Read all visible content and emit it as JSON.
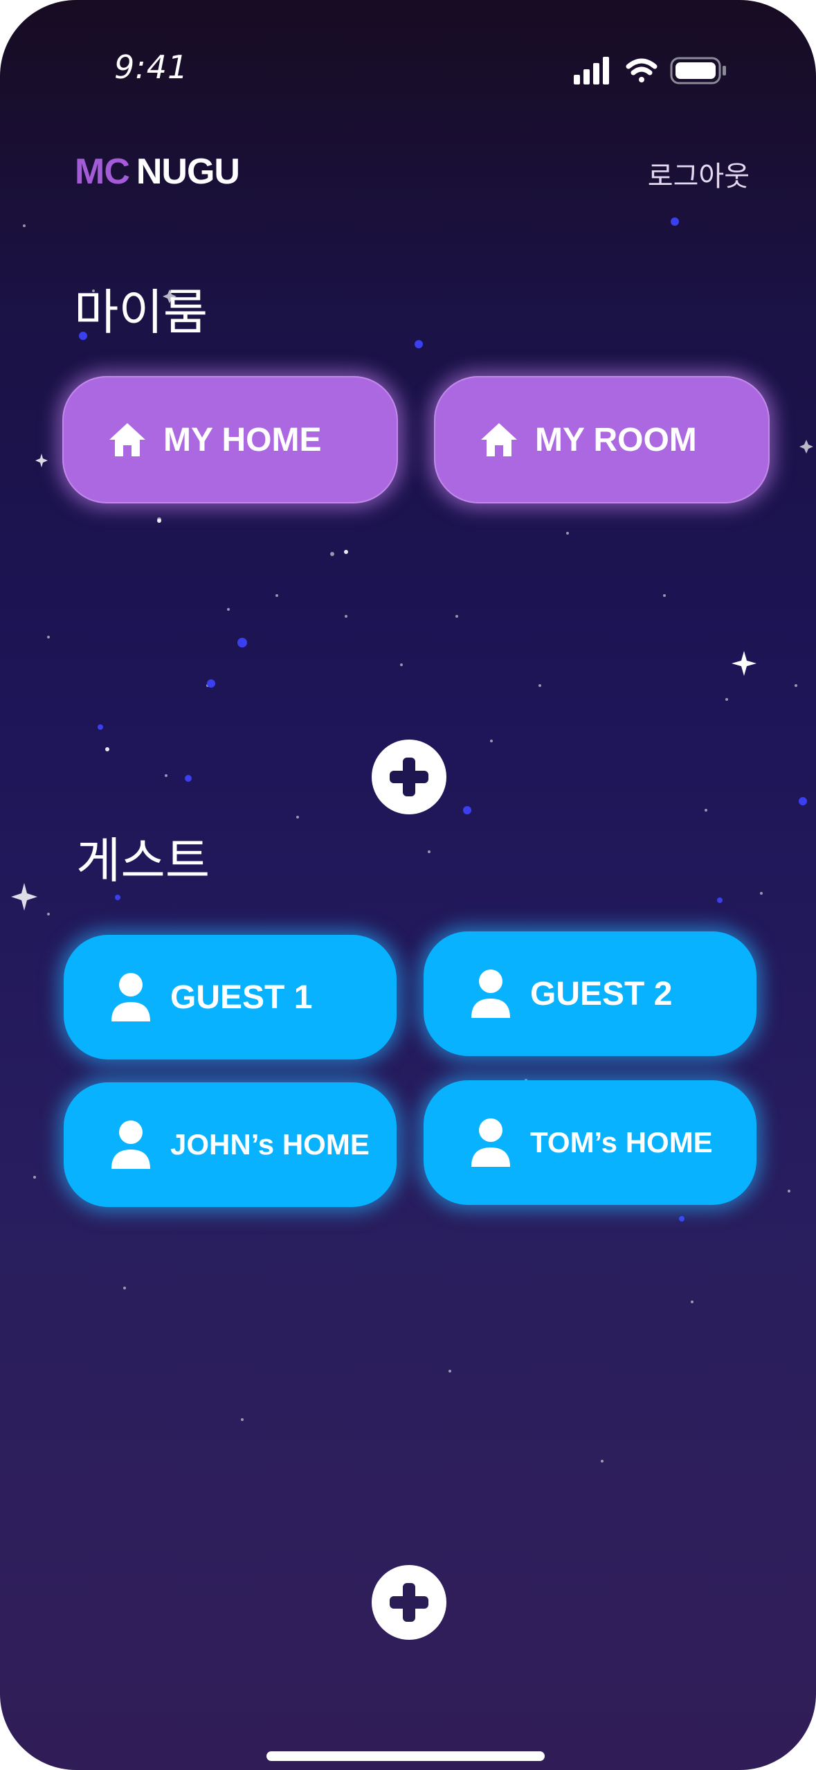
{
  "status_bar": {
    "time": "9:41"
  },
  "header": {
    "logo_mc": "MC",
    "logo_nugu": "NUGU",
    "logout_label": "로그아웃"
  },
  "my_room": {
    "title": "마이룸",
    "items": [
      {
        "label": "MY HOME",
        "icon": "home-icon"
      },
      {
        "label": "MY ROOM",
        "icon": "home-icon"
      }
    ],
    "add_icon": "plus-icon"
  },
  "guest": {
    "title": "게스트",
    "items": [
      {
        "label": "GUEST 1",
        "icon": "user-icon"
      },
      {
        "label": "GUEST 2",
        "icon": "user-icon"
      },
      {
        "label": "JOHN’s HOME",
        "icon": "user-icon"
      },
      {
        "label": "TOM’s HOME",
        "icon": "user-icon"
      }
    ],
    "add_icon": "plus-icon"
  },
  "colors": {
    "room_button": "#ac68e1",
    "guest_button": "#08b2fe",
    "logo_accent": "#a35bd8",
    "background_top": "#170c22",
    "background_bottom": "#301d57"
  }
}
